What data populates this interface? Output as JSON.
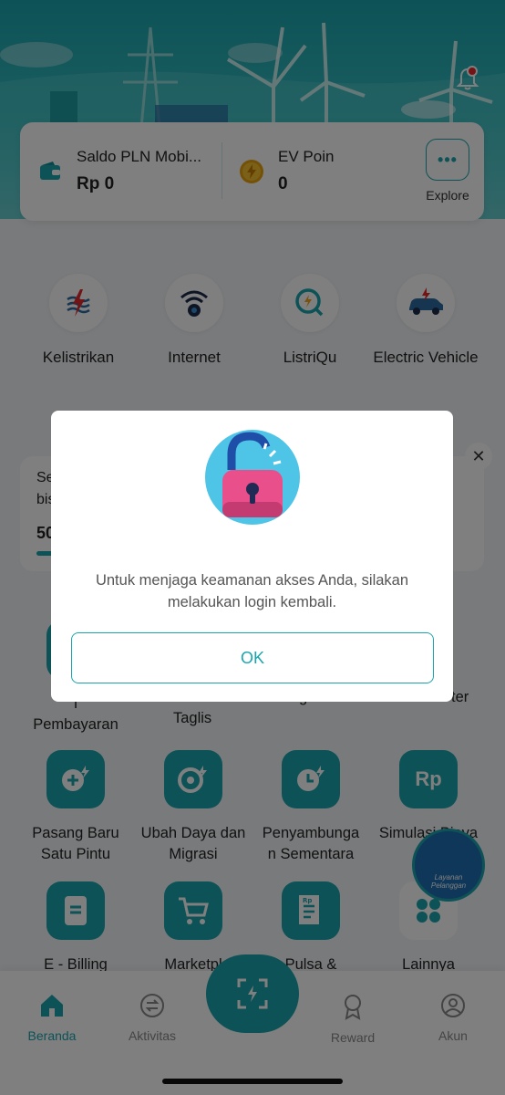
{
  "header": {
    "notification_icon": "bell-icon",
    "colors": {
      "accent": "#1aa5ad",
      "badge": "#e5262a"
    }
  },
  "balance": {
    "saldo_label": "Saldo PLN Mobi...",
    "saldo_value": "Rp 0",
    "ev_label": "EV Poin",
    "ev_value": "0",
    "explore_label": "Explore"
  },
  "categories": [
    {
      "label": "Kelistrikan",
      "icon": "electricity-icon"
    },
    {
      "label": "Internet",
      "icon": "wifi-icon"
    },
    {
      "label": "ListriQu",
      "icon": "listriqu-icon"
    },
    {
      "label": "Electric Vehicle",
      "icon": "electric-car-icon"
    }
  ],
  "promo": {
    "text_line1": "Se",
    "text_line2": "bis",
    "number": "50"
  },
  "services_row1": [
    {
      "line1": "T",
      "line2": "Pembayaran"
    },
    {
      "line1": "",
      "line2": "Taglis"
    },
    {
      "line1": "g",
      "line2": ""
    },
    {
      "line1": "ter",
      "line2": ""
    }
  ],
  "services_row2": [
    {
      "line1": "Pasang Baru",
      "line2": "Satu Pintu",
      "icon": "add-bolt-icon"
    },
    {
      "line1": "Ubah Daya dan",
      "line2": "Migrasi",
      "icon": "power-change-icon"
    },
    {
      "line1": "Penyambunga",
      "line2": "n Sementara",
      "icon": "clock-bolt-icon"
    },
    {
      "line1": "Simulasi Biaya",
      "line2": "",
      "icon": "rupiah-icon"
    }
  ],
  "services_row3": [
    {
      "label": "E - Billing",
      "icon": "billing-icon"
    },
    {
      "label": "Marketpl",
      "icon": "cart-icon"
    },
    {
      "label": "Pulsa &",
      "icon": "receipt-icon"
    },
    {
      "label": "Lainnya",
      "icon": "grid-icon"
    }
  ],
  "customer_service": {
    "line1": "Layanan",
    "line2": "Pelanggan"
  },
  "tabbar": {
    "tabs": [
      {
        "label": "Beranda",
        "icon": "home-icon",
        "active": true
      },
      {
        "label": "Aktivitas",
        "icon": "exchange-icon",
        "active": false
      },
      {
        "label": "Reward",
        "icon": "medal-icon",
        "active": false
      },
      {
        "label": "Akun",
        "icon": "user-icon",
        "active": false
      }
    ],
    "scan_icon": "scan-icon"
  },
  "modal": {
    "message": "Untuk menjaga keamanan akses Anda, silakan melakukan login kembali.",
    "ok_label": "OK",
    "illustration": "unlocked-padlock-icon"
  }
}
